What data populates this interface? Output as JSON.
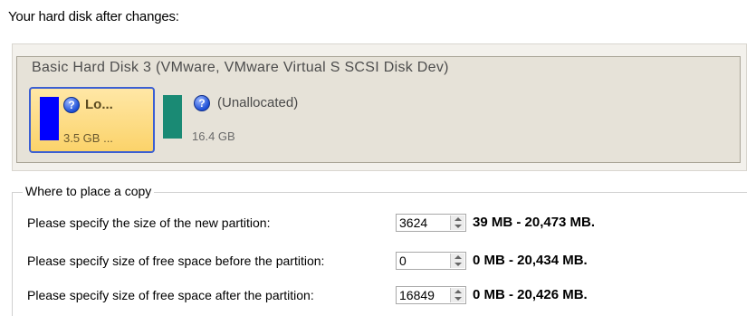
{
  "panel": {
    "title": "Your hard disk after changes:"
  },
  "disk": {
    "title": "Basic Hard Disk 3 (VMware, VMware Virtual S SCSI Disk Dev)",
    "partitions": [
      {
        "name": "Lo...",
        "size": "3.5 GB ...",
        "color": "#0000ff",
        "selected": true
      },
      {
        "name": "(Unallocated)",
        "size": "16.4 GB",
        "color": "#1a8a74",
        "selected": false
      }
    ],
    "help_glyph": "?"
  },
  "placement": {
    "legend": "Where to place a copy",
    "rows": [
      {
        "label": "Please specify the size of the new partition:",
        "value": "3624",
        "range": "39 MB - 20,473 MB."
      },
      {
        "label": "Please specify size of free space before the partition:",
        "value": "0",
        "range": "0 MB - 20,434 MB."
      },
      {
        "label": "Please specify size of free space after the partition:",
        "value": "16849",
        "range": "0 MB - 20,426 MB."
      }
    ]
  }
}
